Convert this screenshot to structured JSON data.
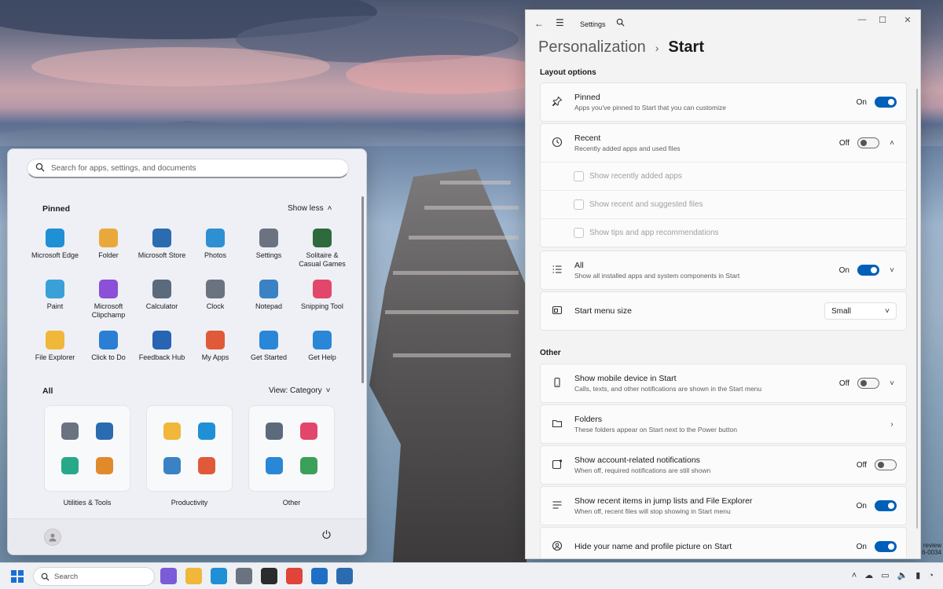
{
  "start_menu": {
    "search_placeholder": "Search for apps, settings, and documents",
    "pinned": {
      "title": "Pinned",
      "action": "Show less",
      "apps": [
        {
          "name": "Microsoft Edge",
          "icon": "edge-icon",
          "color": "#1f8fd6"
        },
        {
          "name": "Folder",
          "icon": "folder-icon",
          "color": "#e9a93a"
        },
        {
          "name": "Microsoft Store",
          "icon": "store-icon",
          "color": "#2b6cb0"
        },
        {
          "name": "Photos",
          "icon": "photos-icon",
          "color": "#2e8fd3"
        },
        {
          "name": "Settings",
          "icon": "gear-icon",
          "color": "#6b7280"
        },
        {
          "name": "Solitaire & Casual Games",
          "icon": "cards-icon",
          "color": "#2f6a3c"
        },
        {
          "name": "Paint",
          "icon": "paint-icon",
          "color": "#3aa0d8"
        },
        {
          "name": "Microsoft Clipchamp",
          "icon": "clipchamp-icon",
          "color": "#8b4fd8"
        },
        {
          "name": "Calculator",
          "icon": "calculator-icon",
          "color": "#5b6b7c"
        },
        {
          "name": "Clock",
          "icon": "clock-icon",
          "color": "#6b7280"
        },
        {
          "name": "Notepad",
          "icon": "notepad-icon",
          "color": "#3b82c4"
        },
        {
          "name": "Snipping Tool",
          "icon": "snipping-icon",
          "color": "#e2476b"
        },
        {
          "name": "File Explorer",
          "icon": "file-explorer-icon",
          "color": "#f0b73a"
        },
        {
          "name": "Click to Do",
          "icon": "click-to-do-icon",
          "color": "#2a7fd4"
        },
        {
          "name": "Feedback Hub",
          "icon": "feedback-icon",
          "color": "#2764b4"
        },
        {
          "name": "My Apps",
          "icon": "my-apps-icon",
          "color": "#e05a3a"
        },
        {
          "name": "Get Started",
          "icon": "get-started-icon",
          "color": "#2a86d6"
        },
        {
          "name": "Get Help",
          "icon": "get-help-icon",
          "color": "#2a86d6"
        }
      ]
    },
    "all": {
      "title": "All",
      "action": "View: Category",
      "folders": [
        {
          "name": "Utilities & Tools",
          "colors": [
            "#6b7280",
            "#2b6cb0",
            "#27a889",
            "#e08a2c"
          ]
        },
        {
          "name": "Productivity",
          "colors": [
            "#f0b73a",
            "#1f8fd6",
            "#3b82c4",
            "#e05a3a"
          ]
        },
        {
          "name": "Other",
          "colors": [
            "#5b6b7c",
            "#e2476b",
            "#2a86d6",
            "#3aa05a"
          ]
        }
      ]
    }
  },
  "settings": {
    "window_title": "Settings",
    "breadcrumb": {
      "parent": "Personalization",
      "separator": "›",
      "current": "Start"
    },
    "layout_options": {
      "title": "Layout options",
      "pinned": {
        "title": "Pinned",
        "desc": "Apps you've pinned to Start that you can customize",
        "state": "On"
      },
      "recent": {
        "title": "Recent",
        "desc": "Recently added apps and used files",
        "state": "Off",
        "sub": [
          "Show recently added apps",
          "Show recent and suggested files",
          "Show tips and app recommendations"
        ]
      },
      "all": {
        "title": "All",
        "desc": "Show all installed apps and system components in Start",
        "state": "On"
      },
      "size": {
        "title": "Start menu size",
        "value": "Small"
      }
    },
    "other": {
      "title": "Other",
      "mobile": {
        "title": "Show mobile device in Start",
        "desc": "Calls, texts, and other notifications are shown in the Start menu",
        "state": "Off"
      },
      "folders": {
        "title": "Folders",
        "desc": "These folders appear on Start next to the Power button"
      },
      "account": {
        "title": "Show account-related notifications",
        "desc": "When off, required notifications are still shown",
        "state": "Off"
      },
      "jumplists": {
        "title": "Show recent items in jump lists and File Explorer",
        "desc": "When off, recent files will stop showing in Start menu",
        "state": "On"
      },
      "profile": {
        "title": "Hide your name and profile picture on Start",
        "state": "On"
      }
    }
  },
  "taskbar": {
    "search_placeholder": "Search",
    "watermark": [
      "review",
      "6-0034"
    ],
    "apps": [
      {
        "icon": "copilot-icon",
        "color": "#7b5cd6"
      },
      {
        "icon": "file-explorer-icon",
        "color": "#f0b73a"
      },
      {
        "icon": "edge-icon",
        "color": "#1f8fd6"
      },
      {
        "icon": "gear-icon",
        "color": "#6b7280"
      },
      {
        "icon": "terminal-icon",
        "color": "#2b2b2b"
      },
      {
        "icon": "chrome-icon",
        "color": "#e0443a"
      },
      {
        "icon": "outlook-icon",
        "color": "#1f6fc5"
      },
      {
        "icon": "store-icon",
        "color": "#2b6cb0"
      }
    ]
  }
}
